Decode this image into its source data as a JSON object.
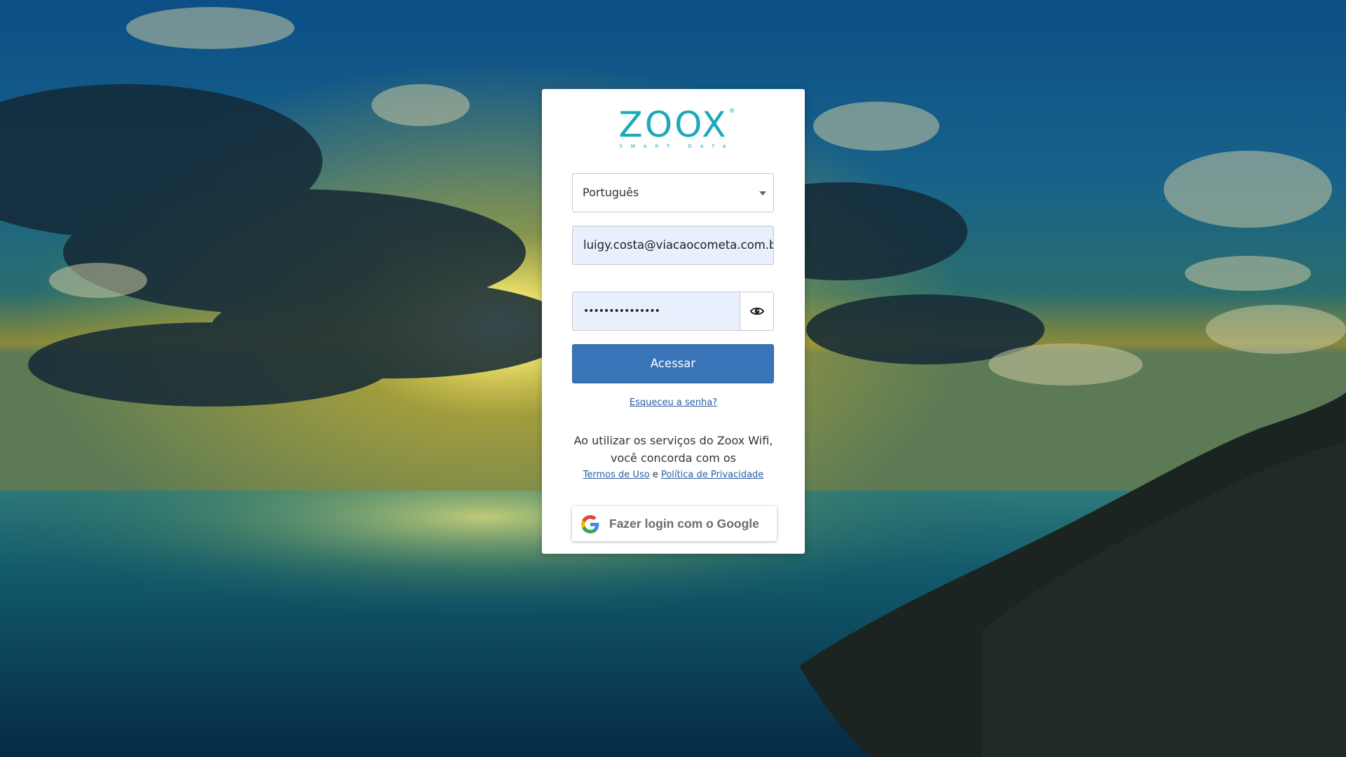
{
  "background": {
    "scene": "sunset-over-ocean",
    "sky_color": "#0e5a7e",
    "sun_color": "#f3e67a",
    "sea_color": "#0b4a5a"
  },
  "logo": {
    "word": "ZOOX",
    "registered": "®",
    "tagline": "SMART DATA",
    "color": "#19aabb"
  },
  "form": {
    "language_select": {
      "value": "Português",
      "icon": "caret-down-icon"
    },
    "email": {
      "value": "luigy.costa@viacaocometa.com.br"
    },
    "password": {
      "value": "•••••••••••••••",
      "toggle_icon": "eye-icon"
    },
    "submit_label": "Acessar",
    "submit_color": "#3874b7",
    "forgot_label": "Esqueceu a senha?"
  },
  "terms": {
    "text": "Ao utilizar os serviços do Zoox Wifi, você concorda com os",
    "terms_link": "Termos de Uso",
    "connector": "e",
    "privacy_link": "Política de Privacidade"
  },
  "google_button": {
    "label": "Fazer login com o Google",
    "icon": "google-icon"
  }
}
